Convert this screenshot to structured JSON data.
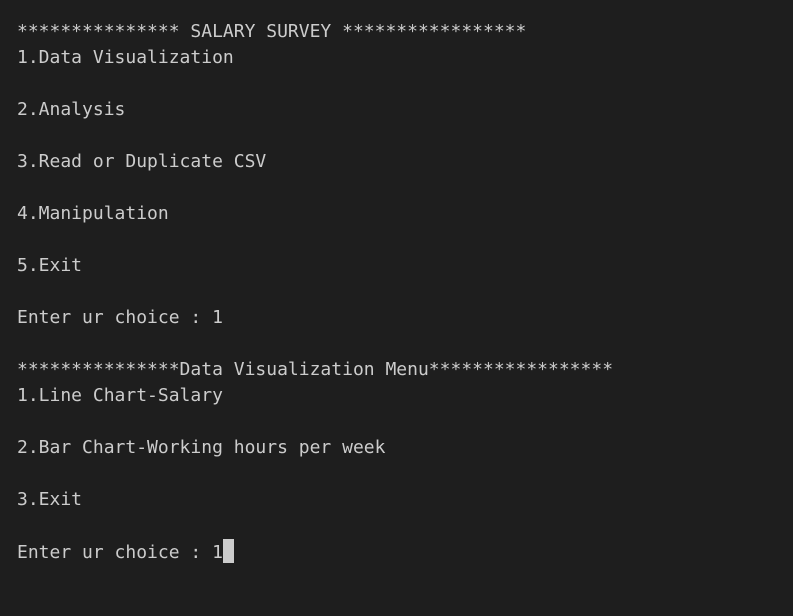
{
  "terminal": {
    "main_header": "*************** SALARY SURVEY *****************",
    "main_menu": [
      "1.Data Visualization",
      "2.Analysis",
      "3.Read or Duplicate CSV",
      "4.Manipulation",
      "5.Exit"
    ],
    "main_prompt": "Enter ur choice : ",
    "main_input": "1",
    "sub_header": "***************Data Visualization Menu*****************",
    "sub_menu": [
      "1.Line Chart-Salary",
      "2.Bar Chart-Working hours per week",
      "3.Exit"
    ],
    "sub_prompt": "Enter ur choice : ",
    "sub_input": "1"
  }
}
